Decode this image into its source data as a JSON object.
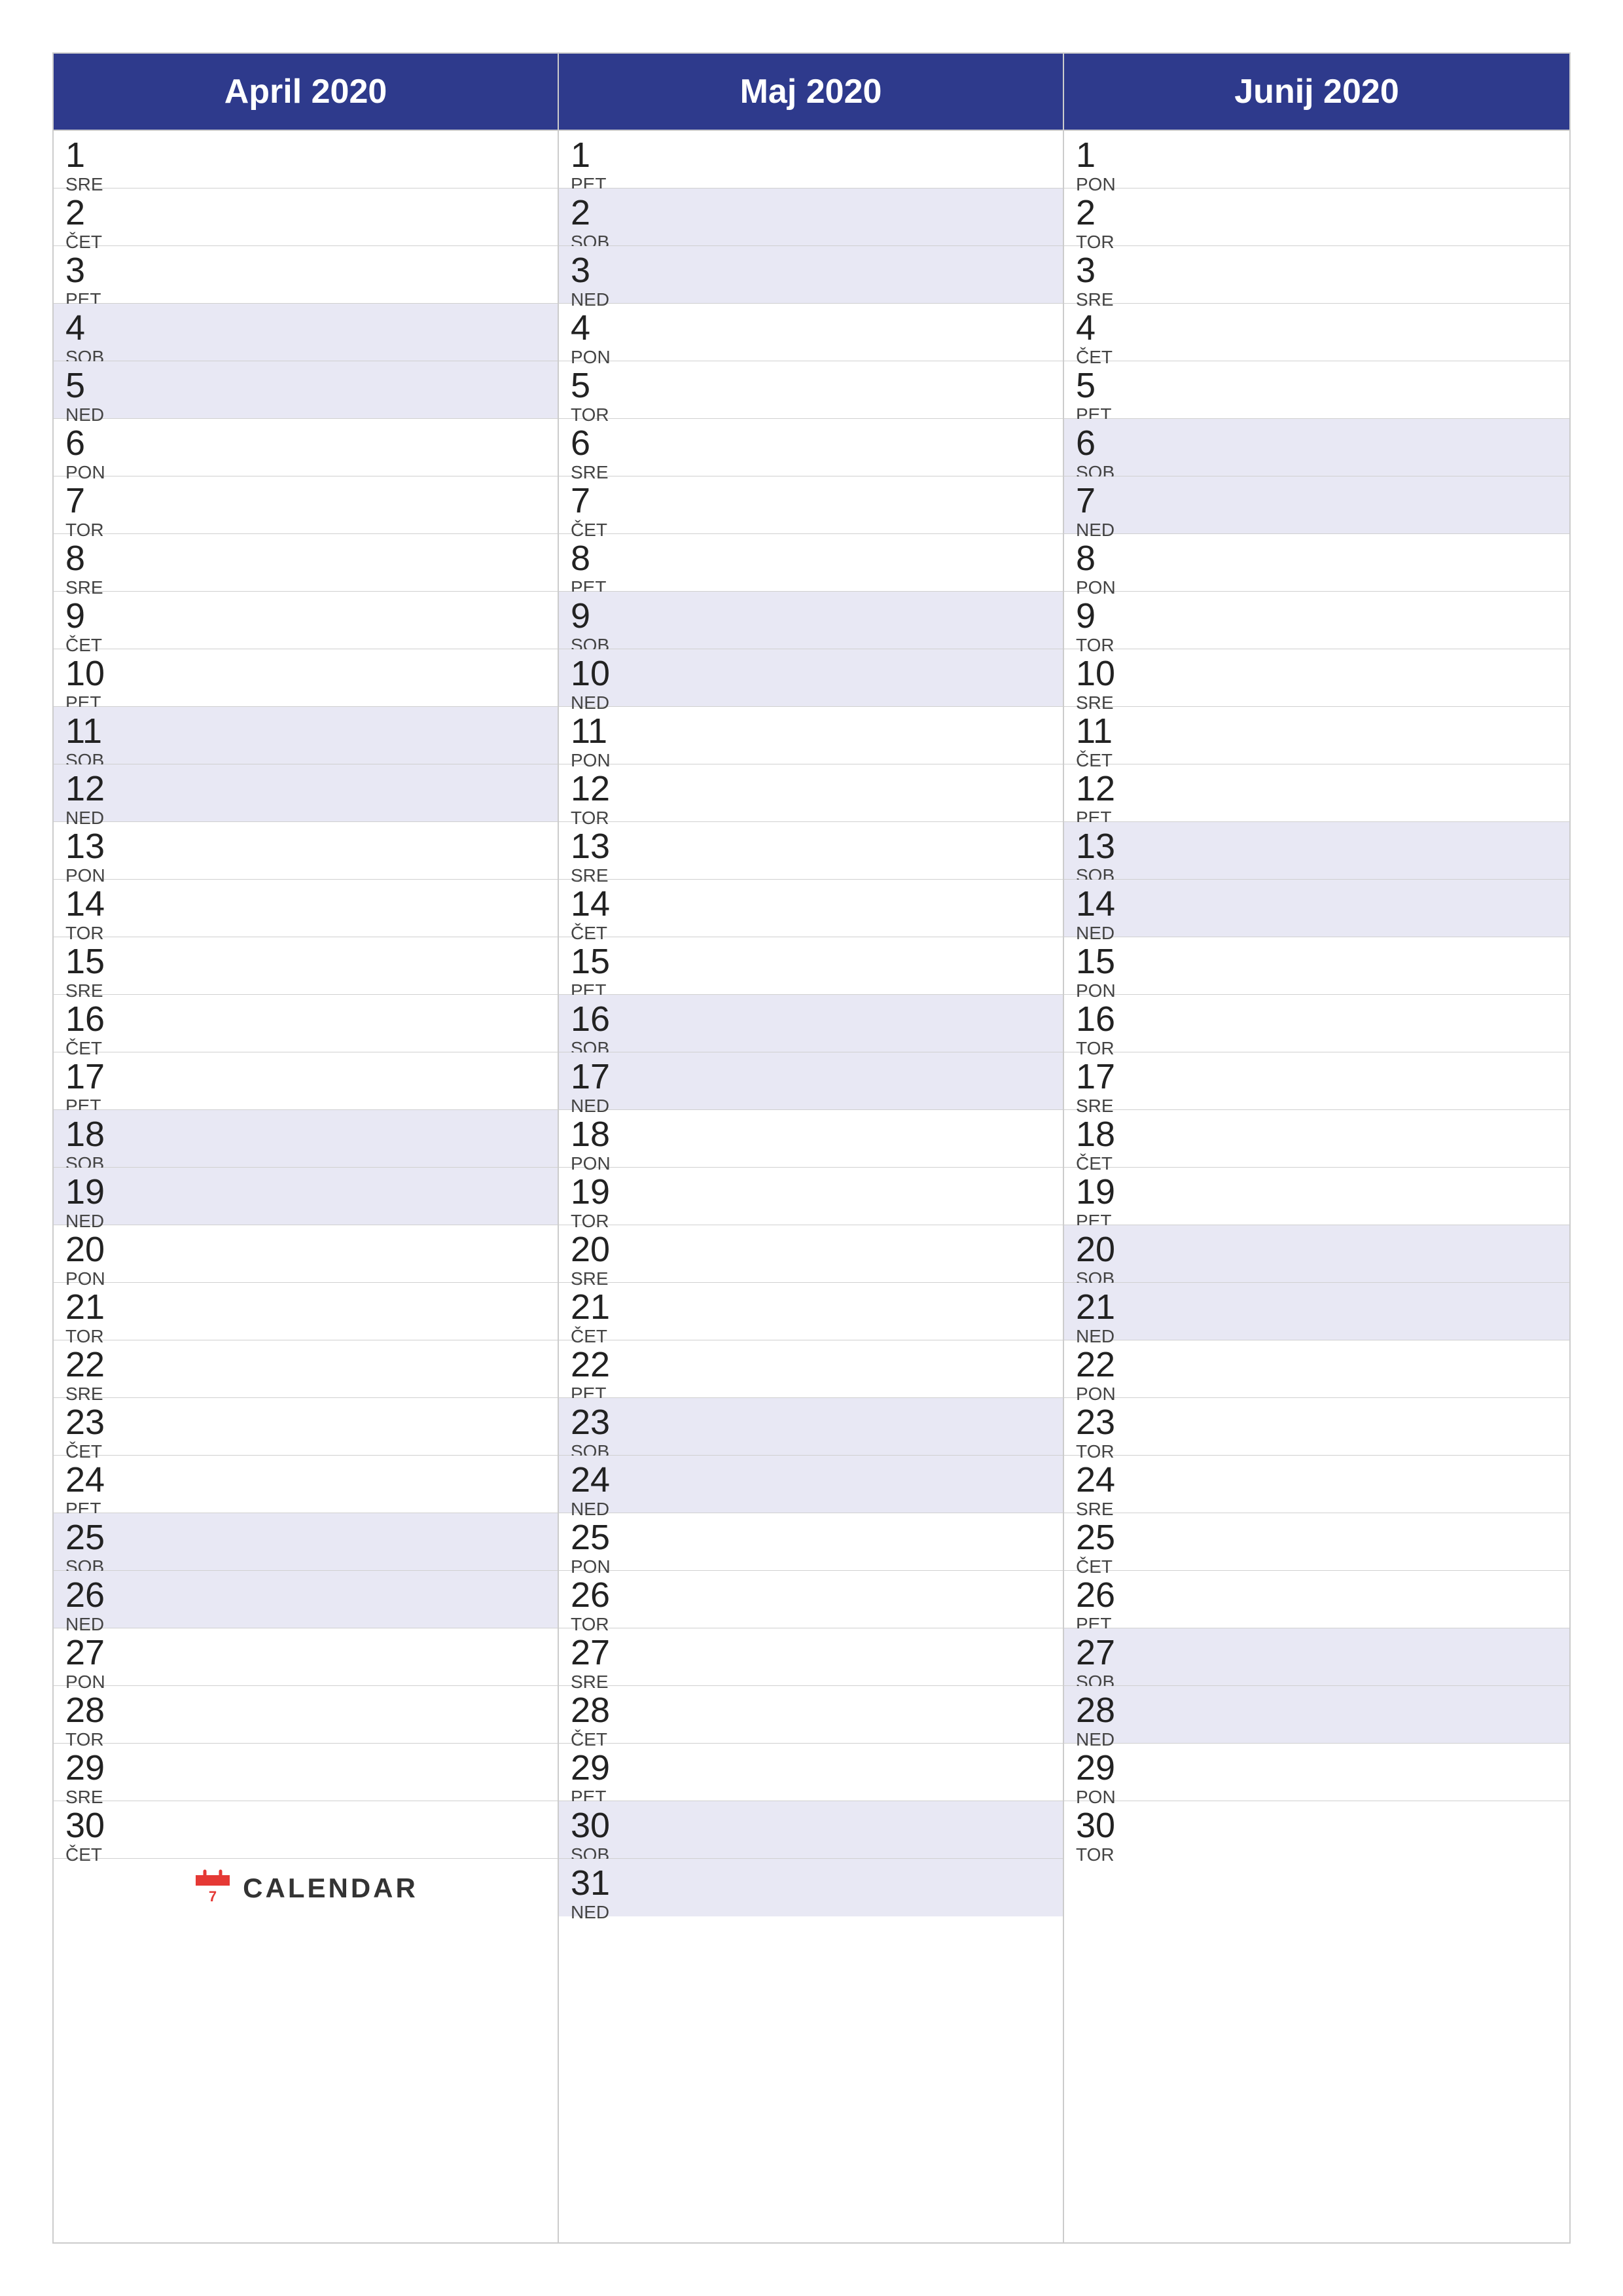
{
  "months": [
    {
      "id": "april",
      "header": "April 2020",
      "days": [
        {
          "num": "1",
          "name": "SRE",
          "weekend": false
        },
        {
          "num": "2",
          "name": "ČET",
          "weekend": false
        },
        {
          "num": "3",
          "name": "PET",
          "weekend": false
        },
        {
          "num": "4",
          "name": "SOB",
          "weekend": true
        },
        {
          "num": "5",
          "name": "NED",
          "weekend": true
        },
        {
          "num": "6",
          "name": "PON",
          "weekend": false
        },
        {
          "num": "7",
          "name": "TOR",
          "weekend": false
        },
        {
          "num": "8",
          "name": "SRE",
          "weekend": false
        },
        {
          "num": "9",
          "name": "ČET",
          "weekend": false
        },
        {
          "num": "10",
          "name": "PET",
          "weekend": false
        },
        {
          "num": "11",
          "name": "SOB",
          "weekend": true
        },
        {
          "num": "12",
          "name": "NED",
          "weekend": true
        },
        {
          "num": "13",
          "name": "PON",
          "weekend": false
        },
        {
          "num": "14",
          "name": "TOR",
          "weekend": false
        },
        {
          "num": "15",
          "name": "SRE",
          "weekend": false
        },
        {
          "num": "16",
          "name": "ČET",
          "weekend": false
        },
        {
          "num": "17",
          "name": "PET",
          "weekend": false
        },
        {
          "num": "18",
          "name": "SOB",
          "weekend": true
        },
        {
          "num": "19",
          "name": "NED",
          "weekend": true
        },
        {
          "num": "20",
          "name": "PON",
          "weekend": false
        },
        {
          "num": "21",
          "name": "TOR",
          "weekend": false
        },
        {
          "num": "22",
          "name": "SRE",
          "weekend": false
        },
        {
          "num": "23",
          "name": "ČET",
          "weekend": false
        },
        {
          "num": "24",
          "name": "PET",
          "weekend": false
        },
        {
          "num": "25",
          "name": "SOB",
          "weekend": true
        },
        {
          "num": "26",
          "name": "NED",
          "weekend": true
        },
        {
          "num": "27",
          "name": "PON",
          "weekend": false
        },
        {
          "num": "28",
          "name": "TOR",
          "weekend": false
        },
        {
          "num": "29",
          "name": "SRE",
          "weekend": false
        },
        {
          "num": "30",
          "name": "ČET",
          "weekend": false
        }
      ],
      "extra": true
    },
    {
      "id": "maj",
      "header": "Maj 2020",
      "days": [
        {
          "num": "1",
          "name": "PET",
          "weekend": false
        },
        {
          "num": "2",
          "name": "SOB",
          "weekend": true
        },
        {
          "num": "3",
          "name": "NED",
          "weekend": true
        },
        {
          "num": "4",
          "name": "PON",
          "weekend": false
        },
        {
          "num": "5",
          "name": "TOR",
          "weekend": false
        },
        {
          "num": "6",
          "name": "SRE",
          "weekend": false
        },
        {
          "num": "7",
          "name": "ČET",
          "weekend": false
        },
        {
          "num": "8",
          "name": "PET",
          "weekend": false
        },
        {
          "num": "9",
          "name": "SOB",
          "weekend": true
        },
        {
          "num": "10",
          "name": "NED",
          "weekend": true
        },
        {
          "num": "11",
          "name": "PON",
          "weekend": false
        },
        {
          "num": "12",
          "name": "TOR",
          "weekend": false
        },
        {
          "num": "13",
          "name": "SRE",
          "weekend": false
        },
        {
          "num": "14",
          "name": "ČET",
          "weekend": false
        },
        {
          "num": "15",
          "name": "PET",
          "weekend": false
        },
        {
          "num": "16",
          "name": "SOB",
          "weekend": true
        },
        {
          "num": "17",
          "name": "NED",
          "weekend": true
        },
        {
          "num": "18",
          "name": "PON",
          "weekend": false
        },
        {
          "num": "19",
          "name": "TOR",
          "weekend": false
        },
        {
          "num": "20",
          "name": "SRE",
          "weekend": false
        },
        {
          "num": "21",
          "name": "ČET",
          "weekend": false
        },
        {
          "num": "22",
          "name": "PET",
          "weekend": false
        },
        {
          "num": "23",
          "name": "SOB",
          "weekend": true
        },
        {
          "num": "24",
          "name": "NED",
          "weekend": true
        },
        {
          "num": "25",
          "name": "PON",
          "weekend": false
        },
        {
          "num": "26",
          "name": "TOR",
          "weekend": false
        },
        {
          "num": "27",
          "name": "SRE",
          "weekend": false
        },
        {
          "num": "28",
          "name": "ČET",
          "weekend": false
        },
        {
          "num": "29",
          "name": "PET",
          "weekend": false
        },
        {
          "num": "30",
          "name": "SOB",
          "weekend": true
        },
        {
          "num": "31",
          "name": "NED",
          "weekend": true
        }
      ],
      "extra": false
    },
    {
      "id": "junij",
      "header": "Junij 2020",
      "days": [
        {
          "num": "1",
          "name": "PON",
          "weekend": false
        },
        {
          "num": "2",
          "name": "TOR",
          "weekend": false
        },
        {
          "num": "3",
          "name": "SRE",
          "weekend": false
        },
        {
          "num": "4",
          "name": "ČET",
          "weekend": false
        },
        {
          "num": "5",
          "name": "PET",
          "weekend": false
        },
        {
          "num": "6",
          "name": "SOB",
          "weekend": true
        },
        {
          "num": "7",
          "name": "NED",
          "weekend": true
        },
        {
          "num": "8",
          "name": "PON",
          "weekend": false
        },
        {
          "num": "9",
          "name": "TOR",
          "weekend": false
        },
        {
          "num": "10",
          "name": "SRE",
          "weekend": false
        },
        {
          "num": "11",
          "name": "ČET",
          "weekend": false
        },
        {
          "num": "12",
          "name": "PET",
          "weekend": false
        },
        {
          "num": "13",
          "name": "SOB",
          "weekend": true
        },
        {
          "num": "14",
          "name": "NED",
          "weekend": true
        },
        {
          "num": "15",
          "name": "PON",
          "weekend": false
        },
        {
          "num": "16",
          "name": "TOR",
          "weekend": false
        },
        {
          "num": "17",
          "name": "SRE",
          "weekend": false
        },
        {
          "num": "18",
          "name": "ČET",
          "weekend": false
        },
        {
          "num": "19",
          "name": "PET",
          "weekend": false
        },
        {
          "num": "20",
          "name": "SOB",
          "weekend": true
        },
        {
          "num": "21",
          "name": "NED",
          "weekend": true
        },
        {
          "num": "22",
          "name": "PON",
          "weekend": false
        },
        {
          "num": "23",
          "name": "TOR",
          "weekend": false
        },
        {
          "num": "24",
          "name": "SRE",
          "weekend": false
        },
        {
          "num": "25",
          "name": "ČET",
          "weekend": false
        },
        {
          "num": "26",
          "name": "PET",
          "weekend": false
        },
        {
          "num": "27",
          "name": "SOB",
          "weekend": true
        },
        {
          "num": "28",
          "name": "NED",
          "weekend": true
        },
        {
          "num": "29",
          "name": "PON",
          "weekend": false
        },
        {
          "num": "30",
          "name": "TOR",
          "weekend": false
        }
      ],
      "extra": false
    }
  ],
  "logo": {
    "text": "CALENDAR",
    "icon_color": "#e53935"
  }
}
